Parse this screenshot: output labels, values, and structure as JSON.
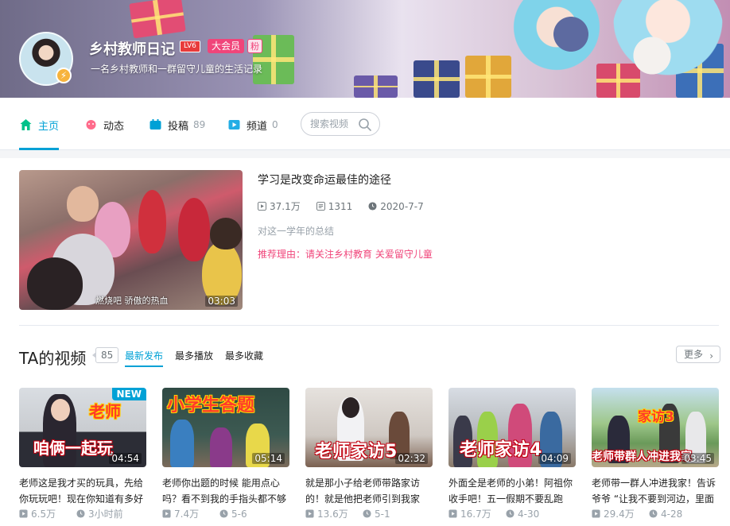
{
  "profile": {
    "name": "乡村教师日记",
    "level": "LV6",
    "vip": "大会员",
    "fan": "粉",
    "sign": "一名乡村教师和一群留守儿童的生活记录"
  },
  "nav": {
    "tabs": [
      {
        "label": "主页",
        "count": ""
      },
      {
        "label": "动态",
        "count": ""
      },
      {
        "label": "投稿",
        "count": "89"
      },
      {
        "label": "频道",
        "count": "0"
      }
    ],
    "search_placeholder": "搜索视频"
  },
  "featured": {
    "title": "学习是改变命运最佳的途径",
    "views": "37.1万",
    "danmaku": "1311",
    "date": "2020-7-7",
    "desc": "对这一学年的总结",
    "reason": "推荐理由：请关注乡村教育 关爱留守儿童",
    "duration": "03:03",
    "caption": "燃烧吧 骄傲的热血"
  },
  "videos_section": {
    "title": "TA的视频",
    "count": "85",
    "sort_tabs": [
      "最新发布",
      "最多播放",
      "最多收藏"
    ],
    "more": "更多"
  },
  "videos": [
    {
      "overlay1": "老师",
      "overlay2": "咱俩一起玩",
      "duration": "04:54",
      "badge": "NEW",
      "title": "老师这是我才买的玩具，先给你玩玩吧！现在你知道有多好",
      "views": "6.5万",
      "time": "3小时前"
    },
    {
      "overlay1": "小学生答题",
      "overlay2": "",
      "duration": "05:14",
      "badge": "",
      "title": "老师你出题的时候 能用点心吗？看不到我的手指头都不够",
      "views": "7.4万",
      "time": "5-6"
    },
    {
      "overlay1": "老师家访5",
      "overlay2": "",
      "duration": "02:32",
      "badge": "",
      "title": "就是那小子给老师带路家访的！就是他把老师引到我家",
      "views": "13.6万",
      "time": "5-1"
    },
    {
      "overlay1": "老师家访4",
      "overlay2": "",
      "duration": "04:09",
      "badge": "",
      "title": "外面全是老师的小弟！阿祖你收手吧！五一假期不要乱跑",
      "views": "16.7万",
      "time": "4-30"
    },
    {
      "overlay1": "家访3",
      "overlay2": "老师带群人冲进我家",
      "duration": "03:45",
      "badge": "",
      "title": "老师带一群人冲进我家！告诉爷爷 “让我不要到河边，里面",
      "views": "29.4万",
      "time": "4-28"
    }
  ],
  "colors": {
    "accent": "#00a1d6",
    "pink": "#f0457a",
    "vip_red": "#e83b3b"
  }
}
